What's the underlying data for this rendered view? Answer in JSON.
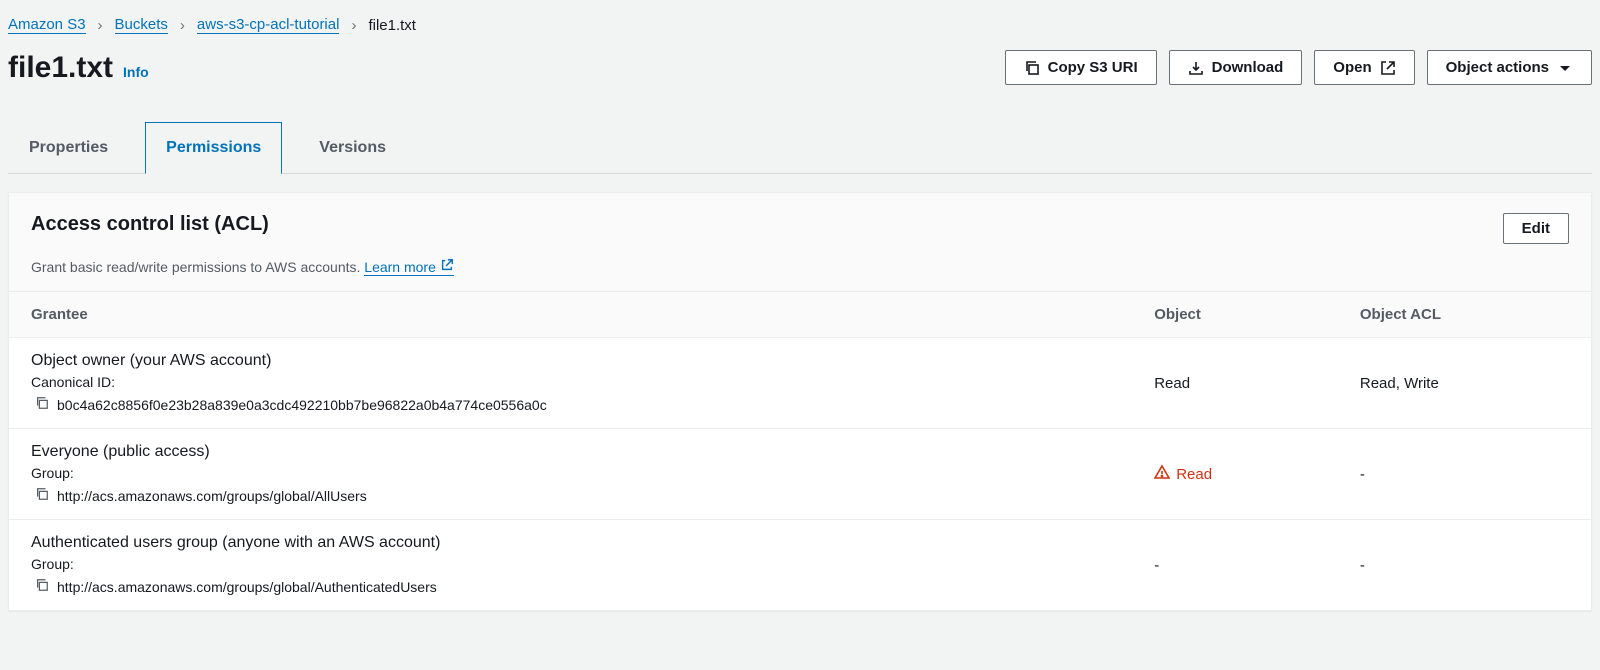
{
  "breadcrumbs": {
    "root": "Amazon S3",
    "buckets": "Buckets",
    "bucket": "aws-s3-cp-acl-tutorial",
    "file": "file1.txt"
  },
  "header": {
    "title": "file1.txt",
    "info": "Info",
    "copy_uri": "Copy S3 URI",
    "download": "Download",
    "open": "Open",
    "actions": "Object actions"
  },
  "tabs": {
    "properties": "Properties",
    "permissions": "Permissions",
    "versions": "Versions"
  },
  "panel": {
    "title": "Access control list (ACL)",
    "desc": "Grant basic read/write permissions to AWS accounts.",
    "learn_more": "Learn more",
    "edit": "Edit"
  },
  "table": {
    "col_grantee": "Grantee",
    "col_object": "Object",
    "col_acl": "Object ACL",
    "rows": [
      {
        "name": "Object owner (your AWS account)",
        "sublabel": "Canonical ID:",
        "id": "b0c4a62c8856f0e23b28a839e0a3cdc492210bb7be96822a0b4a774ce0556a0c",
        "object": "Read",
        "object_warn": false,
        "acl": "Read, Write"
      },
      {
        "name": "Everyone (public access)",
        "sublabel": "Group:",
        "id": "http://acs.amazonaws.com/groups/global/AllUsers",
        "object": "Read",
        "object_warn": true,
        "acl": "-"
      },
      {
        "name": "Authenticated users group (anyone with an AWS account)",
        "sublabel": "Group:",
        "id": "http://acs.amazonaws.com/groups/global/AuthenticatedUsers",
        "object": "-",
        "object_warn": false,
        "acl": "-"
      }
    ]
  }
}
